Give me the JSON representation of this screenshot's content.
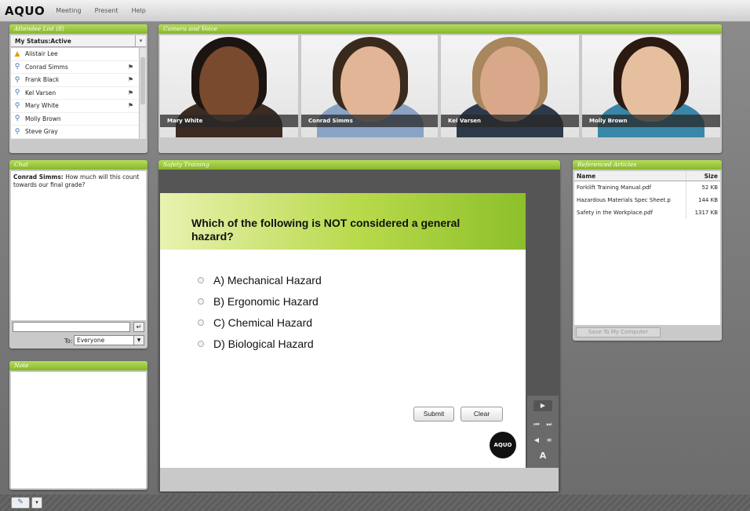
{
  "app": {
    "logo": "AQUO",
    "menu": [
      "Meeting",
      "Present",
      "Help"
    ]
  },
  "attendees": {
    "title": "Attendee List (8)",
    "status": "My Status:Active",
    "list": [
      {
        "name": "Alistair Lee",
        "role": "host",
        "mic": false
      },
      {
        "name": "Conrad Simms",
        "role": "participant",
        "mic": true
      },
      {
        "name": "Frank Black",
        "role": "participant",
        "mic": true
      },
      {
        "name": "Kel Varsen",
        "role": "participant",
        "mic": true
      },
      {
        "name": "Mary White",
        "role": "participant",
        "mic": true
      },
      {
        "name": "Molly Brown",
        "role": "participant",
        "mic": false
      },
      {
        "name": "Steve Gray",
        "role": "participant",
        "mic": false
      }
    ]
  },
  "camera": {
    "title": "Camera and Voice",
    "feeds": [
      {
        "name": "Mary White",
        "skin": "#7a4a2e",
        "hair": "#1c1410",
        "shirt": "#3b2b22"
      },
      {
        "name": "Conrad Simms",
        "skin": "#e2b596",
        "hair": "#3a2a1e",
        "shirt": "#8aa3c4"
      },
      {
        "name": "Kel Varsen",
        "skin": "#d9a88a",
        "hair": "#a8865e",
        "shirt": "#2e3a4a"
      },
      {
        "name": "Molly Brown",
        "skin": "#e6bf9f",
        "hair": "#2b1a12",
        "shirt": "#3a86a8"
      }
    ]
  },
  "chat": {
    "title": "Chat",
    "messages": [
      {
        "sender": "Conrad Simms:",
        "text": " How much will this count towards our final grade?"
      }
    ],
    "to_label": "To:",
    "to_value": "Everyone"
  },
  "note": {
    "title": "Note"
  },
  "training": {
    "title": "Safety Training",
    "question": "Which of the following is NOT considered a general hazard?",
    "options": [
      "A) Mechanical Hazard",
      "B) Ergonomic Hazard",
      "C) Chemical Hazard",
      "D) Biological Hazard"
    ],
    "submit": "Submit",
    "clear": "Clear",
    "badge": "AQUO"
  },
  "articles": {
    "title": "Referenced Articles",
    "columns": [
      "Name",
      "Size"
    ],
    "rows": [
      {
        "name": "Forklift Training Manual.pdf",
        "size": "52 KB"
      },
      {
        "name": "Hazardous Materials Spec Sheet.p",
        "size": "144 KB"
      },
      {
        "name": "Safety in the Workplace.pdf",
        "size": "1317 KB"
      }
    ],
    "save_label": "Save To My Computer"
  },
  "colors": {
    "accent": "#8cc02a",
    "panel": "#c9c9c9"
  }
}
